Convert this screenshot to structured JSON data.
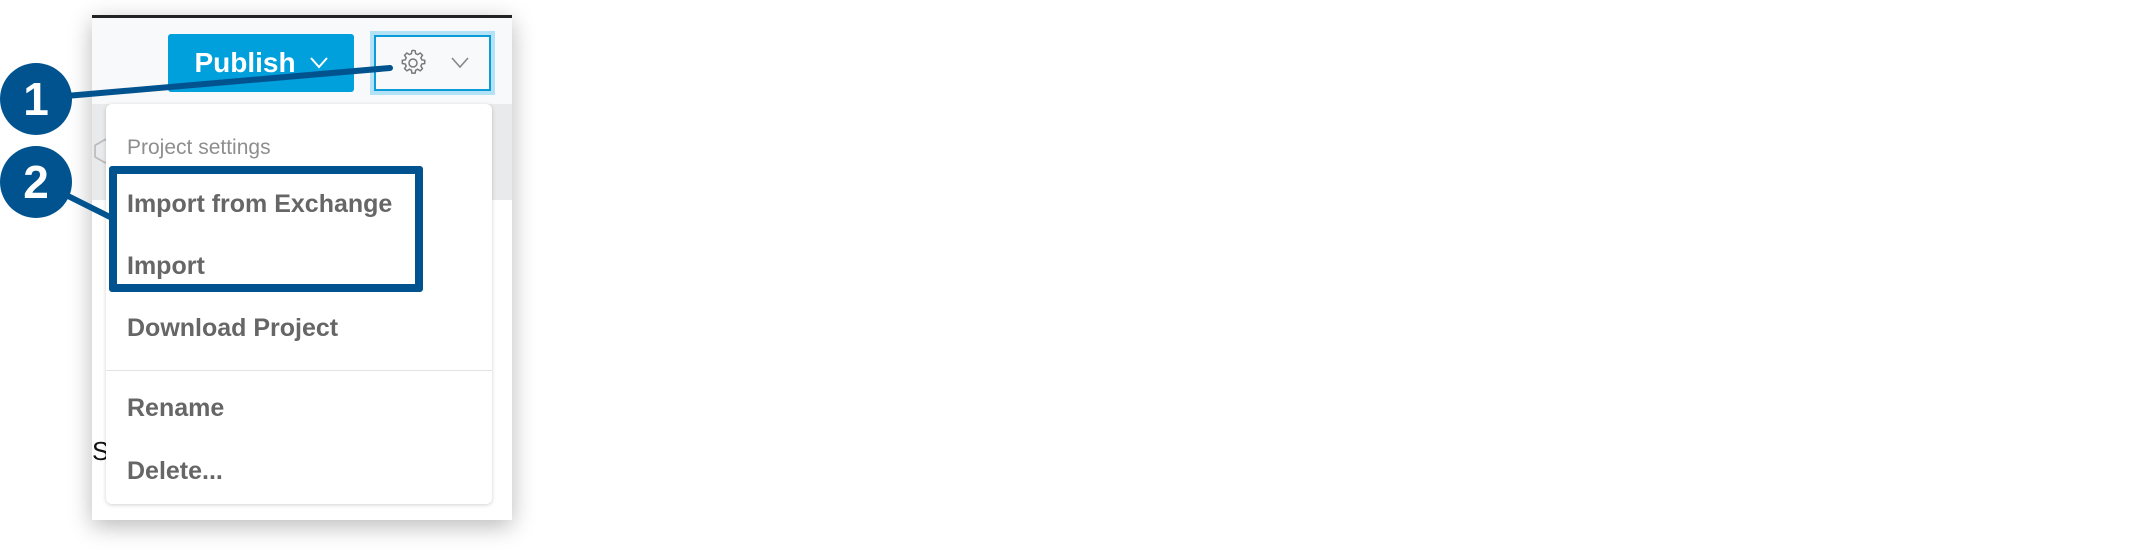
{
  "toolbar": {
    "publish_label": "Publish",
    "publish_chevron": "chevron-down-icon",
    "settings_icon": "gear-icon",
    "settings_chevron": "chevron-down-icon"
  },
  "menu": {
    "header": "Project settings",
    "items": [
      {
        "label": "Import from Exchange"
      },
      {
        "label": "Import"
      },
      {
        "label": "Download Project"
      },
      {
        "label": "Rename"
      },
      {
        "label": "Delete..."
      }
    ]
  },
  "background": {
    "partial_text": "S"
  },
  "callouts": [
    {
      "number": "1"
    },
    {
      "number": "2"
    }
  ],
  "colors": {
    "publish": "#00a0dc",
    "callout": "#00538f",
    "focus_ring": "#b3e1f5"
  }
}
